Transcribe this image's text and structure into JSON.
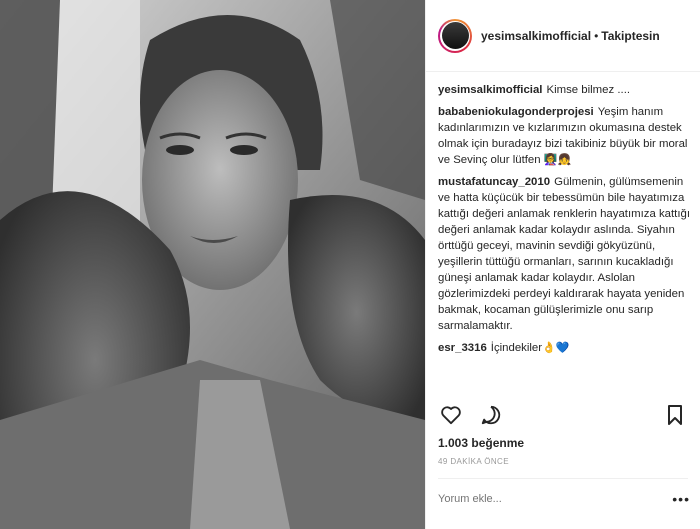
{
  "header": {
    "username": "yesimsalkimofficial",
    "separator": "•",
    "follow_label": "Takiptesin"
  },
  "comments": [
    {
      "user": "yesimsalkimofficial",
      "text": "Kimse bilmez ...."
    },
    {
      "user": "bababeniokulagonderprojesi",
      "text": "Yeşim hanım kadınlarımızın ve kızlarımızın okumasına destek olmak için buradayız bizi takibiniz büyük bir moral ve Sevinç olur lütfen",
      "emoji": "👩‍🏫👧"
    },
    {
      "user": "mustafatuncay_2010",
      "text": "Gülmenin, gülümsemenin ve hatta küçücük bir tebessümün bile hayatımıza kattığı değeri anlamak renklerin hayatımıza kattığı değeri anlamak kadar kolaydır aslında. Siyahın örttüğü geceyi, mavinin sevdiği gökyüzünü, yeşillerin tüttüğü ormanları, sarının kucakladığı güneşi anlamak kadar kolaydır. Aslolan gözlerimizdeki perdeyi kaldırarak hayata yeniden bakmak, kocaman gülüşlerimizle onu sarıp sarmalamaktır."
    },
    {
      "user": "esr_3316",
      "text": "İçindekiler",
      "emoji": "👌💙"
    }
  ],
  "actions": {
    "like_icon": "heart-icon",
    "comment_icon": "comment-icon",
    "save_icon": "bookmark-icon"
  },
  "likes": "1.003 beğenme",
  "timestamp": "49 DAKİKA ÖNCE",
  "comment_input": {
    "placeholder": "Yorum ekle..."
  },
  "more_label": "•••"
}
